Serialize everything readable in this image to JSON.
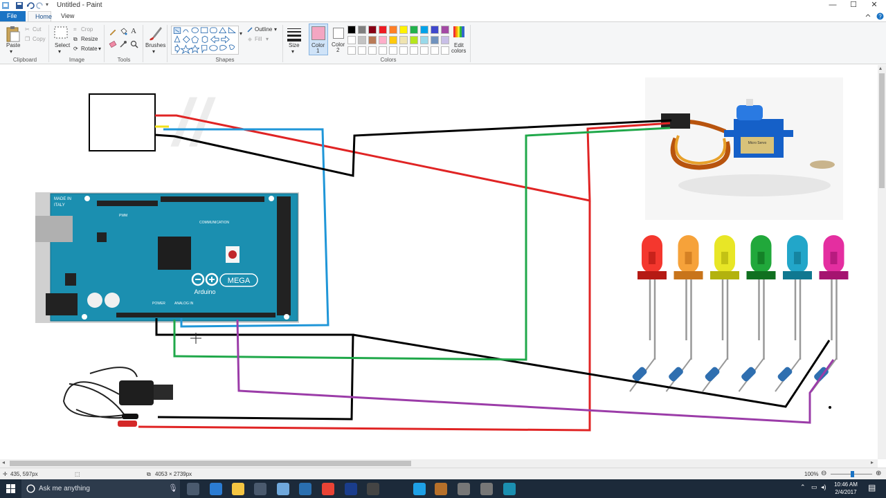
{
  "window": {
    "title": "Untitled - Paint",
    "controls": {
      "minimize": "—",
      "maximize": "☐",
      "close": "✕"
    }
  },
  "tabs": [
    {
      "label": "File"
    },
    {
      "label": "Home"
    },
    {
      "label": "View"
    }
  ],
  "ribbon": {
    "clipboard": {
      "group": "Clipboard",
      "paste": "Paste",
      "cut": "Cut",
      "copy": "Copy"
    },
    "image": {
      "group": "Image",
      "select": "Select",
      "crop": "Crop",
      "resize": "Resize",
      "rotate": "Rotate"
    },
    "tools": {
      "group": "Tools"
    },
    "brushes": {
      "label": "Brushes"
    },
    "shapes": {
      "group": "Shapes",
      "outline": "Outline",
      "fill": "Fill"
    },
    "size": {
      "label": "Size"
    },
    "color1": {
      "label": "Color",
      "label2": "1"
    },
    "color2": {
      "label": "Color",
      "label2": "2"
    },
    "colors": {
      "group": "Colors"
    },
    "edit_colors": {
      "label": "Edit",
      "label2": "colors"
    },
    "palette_row1": [
      "#000000",
      "#7f7f7f",
      "#880015",
      "#ed1c24",
      "#ff7f27",
      "#fff200",
      "#22b14c",
      "#00a2e8",
      "#3f48cc",
      "#a349a4"
    ],
    "palette_row2": [
      "#ffffff",
      "#c3c3c3",
      "#b97a57",
      "#ffaec9",
      "#ffc90e",
      "#efe4b0",
      "#b5e61d",
      "#99d9ea",
      "#7092be",
      "#c8bfe7"
    ],
    "color1_value": "#f3a6c2",
    "color2_value": "#ffffff"
  },
  "canvas": {
    "board_labels": {
      "made_in": "MADE IN",
      "italy": "ITALY",
      "mega": "MEGA",
      "arduino": "Arduino",
      "communication": "COMMUNICATION",
      "pwm": "PWM",
      "power": "POWER",
      "analog_in": "ANALOG IN"
    },
    "servo_label": "Micro Servo"
  },
  "statusbar": {
    "cursor_pos": "435, 597px",
    "image_size": "4053 × 2739px",
    "zoom": "100%"
  },
  "taskbar": {
    "search_placeholder": "Ask me anything",
    "time": "10:46 AM",
    "date": "2/4/2017"
  }
}
